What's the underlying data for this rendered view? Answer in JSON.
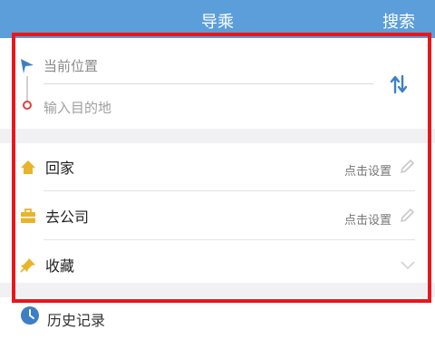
{
  "header": {
    "title": "导乘",
    "search_label": "搜索"
  },
  "route": {
    "start_label": "当前位置",
    "destination_placeholder": "输入目的地"
  },
  "items": [
    {
      "label": "回家",
      "hint": "点击设置",
      "icon": "home-icon"
    },
    {
      "label": "去公司",
      "hint": "点击设置",
      "icon": "briefcase-icon"
    },
    {
      "label": "收藏",
      "icon": "pin-icon"
    }
  ],
  "history": {
    "label": "历史记录",
    "icon": "clock-icon"
  },
  "colors": {
    "header_bg": "#5b9ed9",
    "accent": "#3d7fc4",
    "highlight_border": "#e8171c",
    "home_icon": "#e9b42b"
  }
}
